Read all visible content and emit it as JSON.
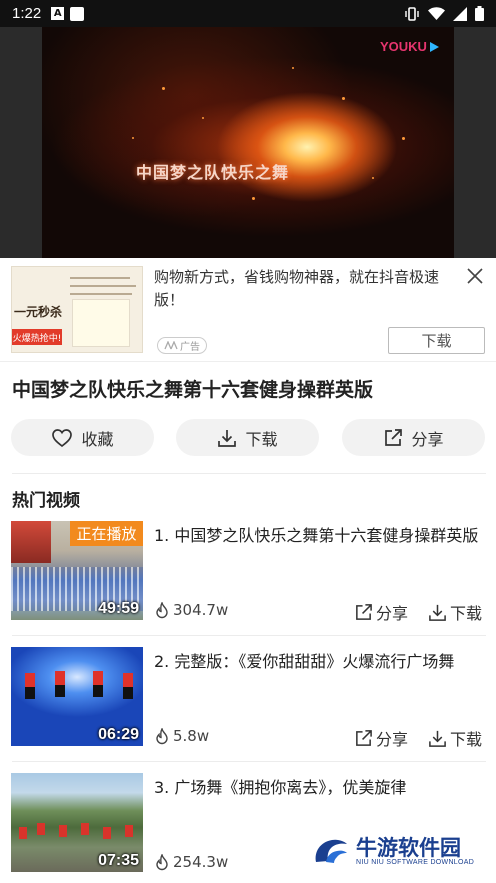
{
  "status_bar": {
    "time": "1:22",
    "notif_letter": "A"
  },
  "player": {
    "brand": "YOUKU",
    "overlay_text": "中国梦之队快乐之舞"
  },
  "ad": {
    "text": "购物新方式，省钱购物神器，就在抖音极速版！",
    "badge": "广告",
    "download_label": "下载",
    "thumb_big_text": "一元秒杀",
    "thumb_red_text": "火爆热抢中!"
  },
  "video": {
    "title": "中国梦之队快乐之舞第十六套健身操群英版"
  },
  "actions": {
    "collect": "收藏",
    "download": "下载",
    "share": "分享"
  },
  "section": {
    "title": "热门视频"
  },
  "list": [
    {
      "title": "1. 中国梦之队快乐之舞第十六套健身操群英版",
      "duration": "49:59",
      "plays": "304.7w",
      "playing": "正在播放",
      "share": "分享",
      "download": "下载"
    },
    {
      "title": "2. 完整版：《爱你甜甜甜》火爆流行广场舞",
      "duration": "06:29",
      "plays": "5.8w",
      "share": "分享",
      "download": "下载"
    },
    {
      "title": "3. 广场舞《拥抱你离去》，优美旋律",
      "duration": "07:35",
      "plays": "254.3w"
    }
  ],
  "watermark": {
    "name": "牛游软件园",
    "sub": "NIU NIU SOFTWARE DOWNLOAD"
  },
  "colors": {
    "accent": "#f28a1e",
    "youku": "#e7356f",
    "watermark": "#1a3f8f"
  }
}
